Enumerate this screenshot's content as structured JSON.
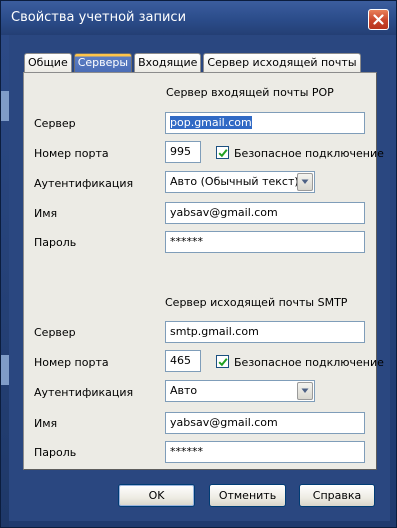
{
  "window": {
    "title": "Свойства учетной записи"
  },
  "tabs": [
    {
      "label": "Общие",
      "active": false
    },
    {
      "label": "Серверы",
      "active": true
    },
    {
      "label": "Входящие",
      "active": false
    },
    {
      "label": "Сервер исходящей почты",
      "active": false
    }
  ],
  "incoming": {
    "section_title": "Сервер входящей почты POP",
    "server_label": "Сервер",
    "server_value": "pop.gmail.com",
    "port_label": "Номер порта",
    "port_value": "995",
    "secure_label": "Безопасное подключение",
    "secure_checked": true,
    "auth_label": "Аутентификация",
    "auth_value": "Авто  (Обычный текст)",
    "name_label": "Имя",
    "name_value": "yabsav@gmail.com",
    "password_label": "Пароль",
    "password_value": "******"
  },
  "outgoing": {
    "section_title": "Сервер исходящей почты SMTP",
    "server_label": "Сервер",
    "server_value": "smtp.gmail.com",
    "port_label": "Номер порта",
    "port_value": "465",
    "secure_label": "Безопасное подключение",
    "secure_checked": true,
    "auth_label": "Аутентификация",
    "auth_value": "Авто",
    "name_label": "Имя",
    "name_value": "yabsav@gmail.com",
    "password_label": "Пароль",
    "password_value": "******"
  },
  "footer": {
    "ok_label": "OK",
    "cancel_label": "Отменить",
    "help_label": "Справка"
  },
  "icons": {
    "close": "close-icon",
    "checkmark": "checkmark-icon",
    "dropdown": "chevron-down-icon"
  },
  "colors": {
    "titlebar": "#2b4c8a",
    "active_tab": "#4a6cb5",
    "active_tab_accent": "#ffc54a",
    "panel": "#ecebe5",
    "close_button": "#c9452c",
    "selection": "#316ac5"
  }
}
